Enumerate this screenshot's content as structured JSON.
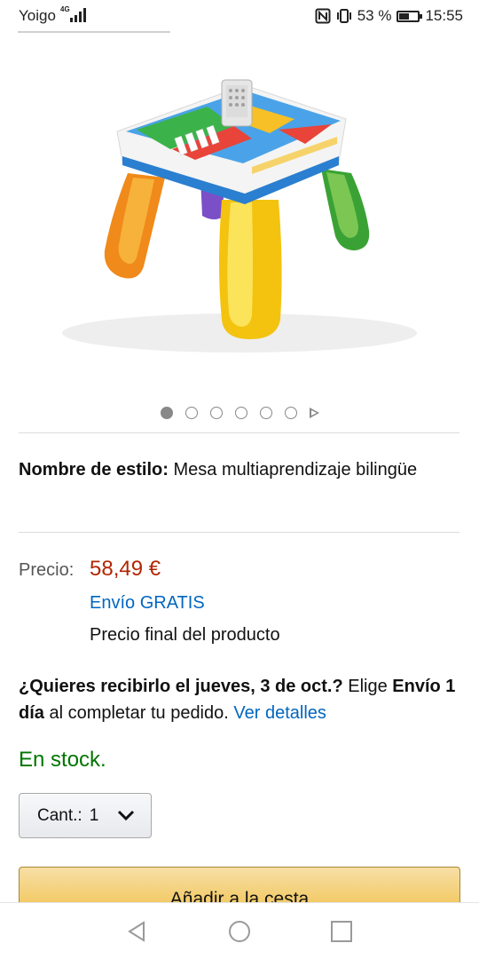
{
  "status_bar": {
    "carrier": "Yoigo",
    "network": "4G",
    "battery": "53 %",
    "battery_level": 0.53,
    "time": "15:55"
  },
  "product": {
    "image_icon": "activity-table-image",
    "carousel": {
      "total": 6,
      "active": 0
    }
  },
  "style": {
    "label": "Nombre de estilo:",
    "value": "Mesa multiaprendizaje bilingüe"
  },
  "price": {
    "label": "Precio:",
    "value": "58,49 €",
    "shipping": "Envío GRATIS",
    "note": "Precio final del producto",
    "color": "#b12704"
  },
  "delivery": {
    "q_bold": "¿Quieres recibirlo el jueves, 3 de oct.?",
    "q_rest": " Elige ",
    "method_bold": "Envío 1 día",
    "method_rest": " al completar tu pedido. ",
    "link": "Ver detalles"
  },
  "availability": {
    "text": "En stock.",
    "color": "#007600"
  },
  "quantity": {
    "label": "Cant.:",
    "value": "1"
  },
  "add_to_cart": {
    "label": "Añadir a la cesta"
  },
  "nav": {
    "back_icon": "back-triangle-icon",
    "home_icon": "home-circle-icon",
    "recents_icon": "recents-square-icon"
  }
}
